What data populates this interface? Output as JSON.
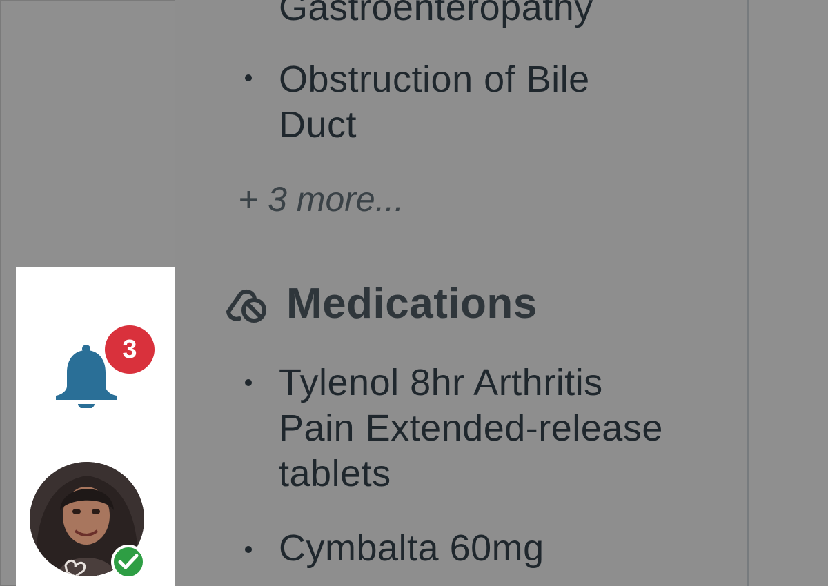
{
  "conditions": {
    "items": [
      {
        "label": "Gastroenteropathy"
      },
      {
        "label_line1": "Obstruction of Bile",
        "label_line2": "Duct"
      }
    ],
    "more_label": "+ 3 more..."
  },
  "medications": {
    "title": "Medications",
    "icon": "pill-cancel-icon",
    "items": [
      {
        "line1": "Tylenol 8hr Arthritis",
        "line2": "Pain Extended-release",
        "line3": "tablets"
      },
      {
        "line1": "Cymbalta 60mg"
      }
    ]
  },
  "notifications": {
    "icon": "bell-icon",
    "count": "3",
    "badge_color": "#d9313c"
  },
  "user": {
    "avatar_icon": "user-avatar",
    "status_icon": "check-icon",
    "status_color": "#2e9e44"
  },
  "colors": {
    "accent": "#2a6f97",
    "overlay": "#8f8f8f"
  }
}
